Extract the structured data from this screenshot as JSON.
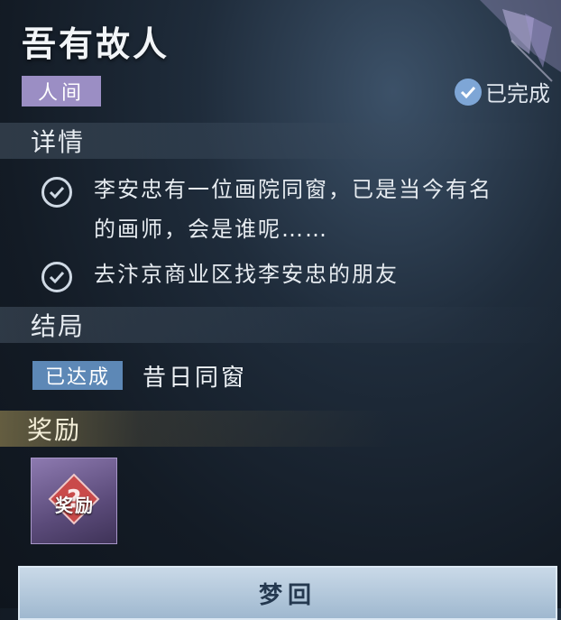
{
  "quest": {
    "title": "吾有故人",
    "realm_tag": "人间",
    "status_label": "已完成"
  },
  "details": {
    "heading": "详情",
    "items": [
      {
        "line1": "李安忠有一位画院同窗，已是当今有名",
        "line2": "的画师，会是谁呢……",
        "done": true
      },
      {
        "line1": "去汴京商业区找李安忠的朋友",
        "done": true
      }
    ]
  },
  "ending": {
    "heading": "结局",
    "achieved_label": "已达成",
    "name": "昔日同窗"
  },
  "rewards": {
    "heading": "奖励",
    "items": [
      {
        "label": "奖励",
        "icon": "mystery-reward-icon"
      }
    ]
  },
  "actions": {
    "dream_label": "梦回"
  },
  "colors": {
    "realm_tag_bg": "#9b8ec4",
    "achieved_bg": "#5d88b6",
    "reward_tile_bg": "#6a5a8c",
    "button_bg": "#b3c8dc"
  }
}
